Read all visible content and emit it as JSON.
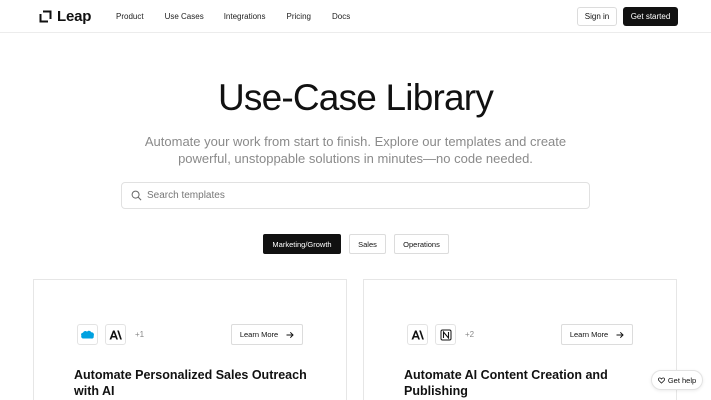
{
  "brand": {
    "name": "Leap"
  },
  "nav": {
    "links": [
      "Product",
      "Use Cases",
      "Integrations",
      "Pricing",
      "Docs"
    ],
    "sign_in": "Sign in",
    "get_started": "Get started"
  },
  "hero": {
    "title": "Use-Case Library",
    "subtitle": "Automate your work from start to finish. Explore our templates and create powerful, unstoppable solutions in minutes—no code needed."
  },
  "search": {
    "placeholder": "Search templates",
    "value": ""
  },
  "tabs": [
    {
      "label": "Marketing/Growth",
      "active": true
    },
    {
      "label": "Sales",
      "active": false
    },
    {
      "label": "Operations",
      "active": false
    }
  ],
  "cards": [
    {
      "icons": [
        "salesforce-icon",
        "anthropic-icon"
      ],
      "extra": "+1",
      "cta": "Learn More",
      "title": "Automate Personalized Sales Outreach with AI"
    },
    {
      "icons": [
        "anthropic-icon",
        "notion-icon"
      ],
      "extra": "+2",
      "cta": "Learn More",
      "title": "Automate AI Content Creation and Publishing"
    }
  ],
  "help": {
    "label": "Get help"
  },
  "colors": {
    "primary": "#111111",
    "muted_text": "#8a8a8a",
    "border": "#e1e1e1",
    "salesforce": "#00a1e0"
  }
}
